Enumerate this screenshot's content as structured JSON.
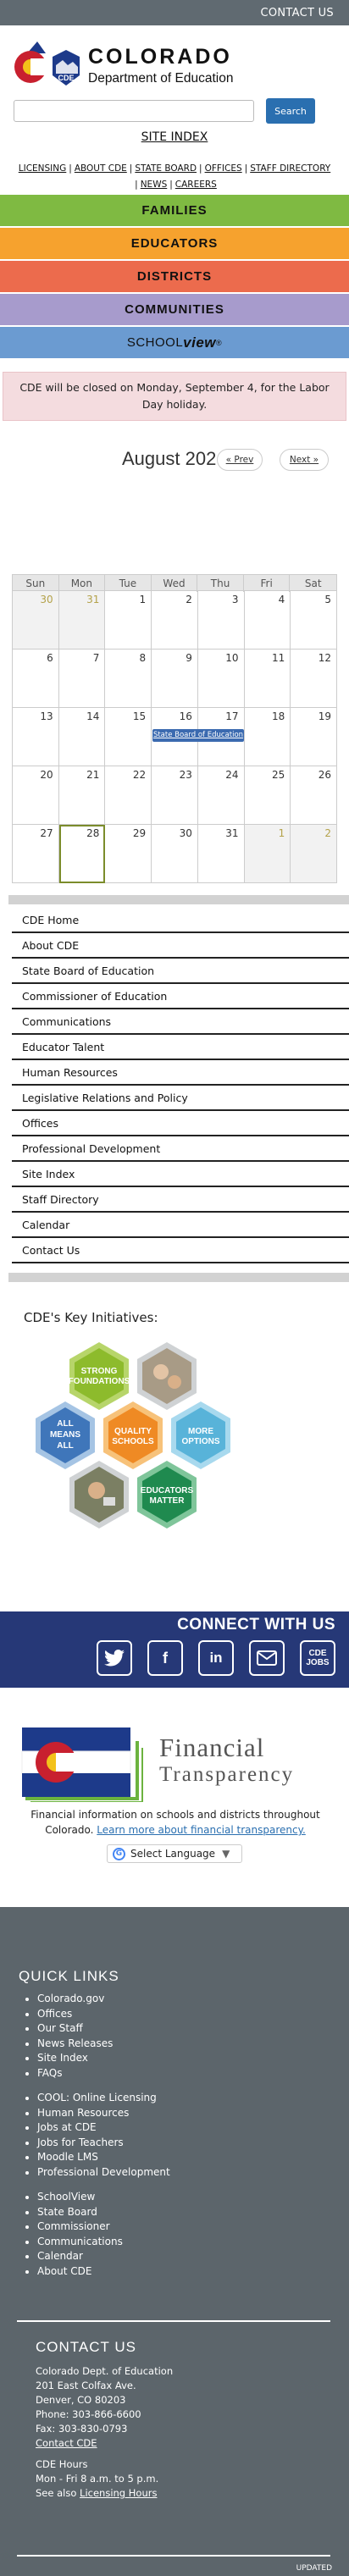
{
  "topbar": {
    "contact_label": "CONTACT US"
  },
  "logo": {
    "line1": "COLORADO",
    "line2": "Department of Education",
    "badge": "CDE"
  },
  "search": {
    "button_label": "Search",
    "placeholder": ""
  },
  "site_index_label": "SITE INDEX",
  "util_nav": {
    "row1": [
      "LICENSING",
      "ABOUT CDE",
      "STATE BOARD",
      "OFFICES",
      "STAFF DIRECTORY"
    ],
    "row2": [
      "NEWS",
      "CAREERS"
    ]
  },
  "mega_nav": [
    {
      "label": "FAMILIES",
      "color": "#7fba42"
    },
    {
      "label": "EDUCATORS",
      "color": "#f6a22e"
    },
    {
      "label": "DISTRICTS",
      "color": "#ec6b4d"
    },
    {
      "label": "COMMUNITIES",
      "color": "#a79bcc"
    }
  ],
  "schoolview": {
    "label1": "SCHOOL",
    "label2": "view",
    "mark": "®",
    "color": "#6b9bd1"
  },
  "alert": {
    "text": "CDE will be closed on Monday, September 4, for the Labor Day holiday."
  },
  "calendar": {
    "month_title": "August 202",
    "prev_label": "« Prev",
    "next_label": "Next »",
    "weekdays": [
      "Sun",
      "Mon",
      "Tue",
      "Wed",
      "Thu",
      "Fri",
      "Sat"
    ],
    "weeks": [
      [
        "30",
        "31",
        "1",
        "2",
        "3",
        "4",
        "5"
      ],
      [
        "6",
        "7",
        "8",
        "9",
        "10",
        "11",
        "12"
      ],
      [
        "13",
        "14",
        "15",
        "16",
        "17",
        "18",
        "19"
      ],
      [
        "20",
        "21",
        "22",
        "23",
        "24",
        "25",
        "26"
      ],
      [
        "27",
        "28",
        "29",
        "30",
        "31",
        "1",
        "2"
      ]
    ],
    "event_label": "State Board of Education"
  },
  "site_nav": [
    "CDE Home",
    "About CDE",
    "State Board of Education",
    "Commissioner of Education",
    "Communications",
    "Educator Talent",
    "Human Resources",
    "Legislative Relations and Policy",
    "Offices",
    "Professional Development",
    "Site Index",
    "Staff Directory",
    "Calendar",
    "Contact Us"
  ],
  "initiatives": {
    "title": "CDE's Key Initiatives:",
    "hex_labels": {
      "strong": [
        "STRONG",
        "FOUNDATIONS"
      ],
      "all": [
        "ALL",
        "MEANS",
        "ALL"
      ],
      "quality": [
        "QUALITY",
        "SCHOOLS"
      ],
      "options": [
        "MORE",
        "OPTIONS"
      ],
      "educators": [
        "EDUCATORS",
        "MATTER"
      ]
    }
  },
  "connect": {
    "title": "CONNECT WITH US",
    "jobs_label": [
      "CDE",
      "JOBS"
    ]
  },
  "financial": {
    "title1": "Financial",
    "title2": "Transparency",
    "desc": "Financial information on schools and districts throughout Colorado.",
    "link": "Learn more about financial transparency."
  },
  "language": {
    "label": "Select Language"
  },
  "footer": {
    "quick_links_title": "QUICK LINKS",
    "group1": [
      "Colorado.gov",
      "Offices",
      "Our Staff",
      "News Releases",
      "Site Index",
      "FAQs"
    ],
    "group2": [
      "COOL: Online Licensing",
      "Human Resources",
      "Jobs at CDE",
      "Jobs for Teachers",
      "Moodle LMS",
      "Professional Development"
    ],
    "group3": [
      "SchoolView",
      "State Board",
      "Commissioner",
      "Communications",
      "Calendar",
      "About CDE"
    ],
    "contact_title": "CONTACT US",
    "address": [
      "Colorado Dept. of Education",
      "201 East Colfax Ave.",
      "Denver, CO 80203",
      "Phone: 303-866-6600",
      "Fax: 303-830-0793"
    ],
    "contact_link": "Contact CDE",
    "hours_title": "CDE Hours",
    "hours": "Mon - Fri 8 a.m. to 5 p.m.",
    "see_also": "See also",
    "licensing_hours": "Licensing Hours",
    "updated": "UPDATED"
  }
}
